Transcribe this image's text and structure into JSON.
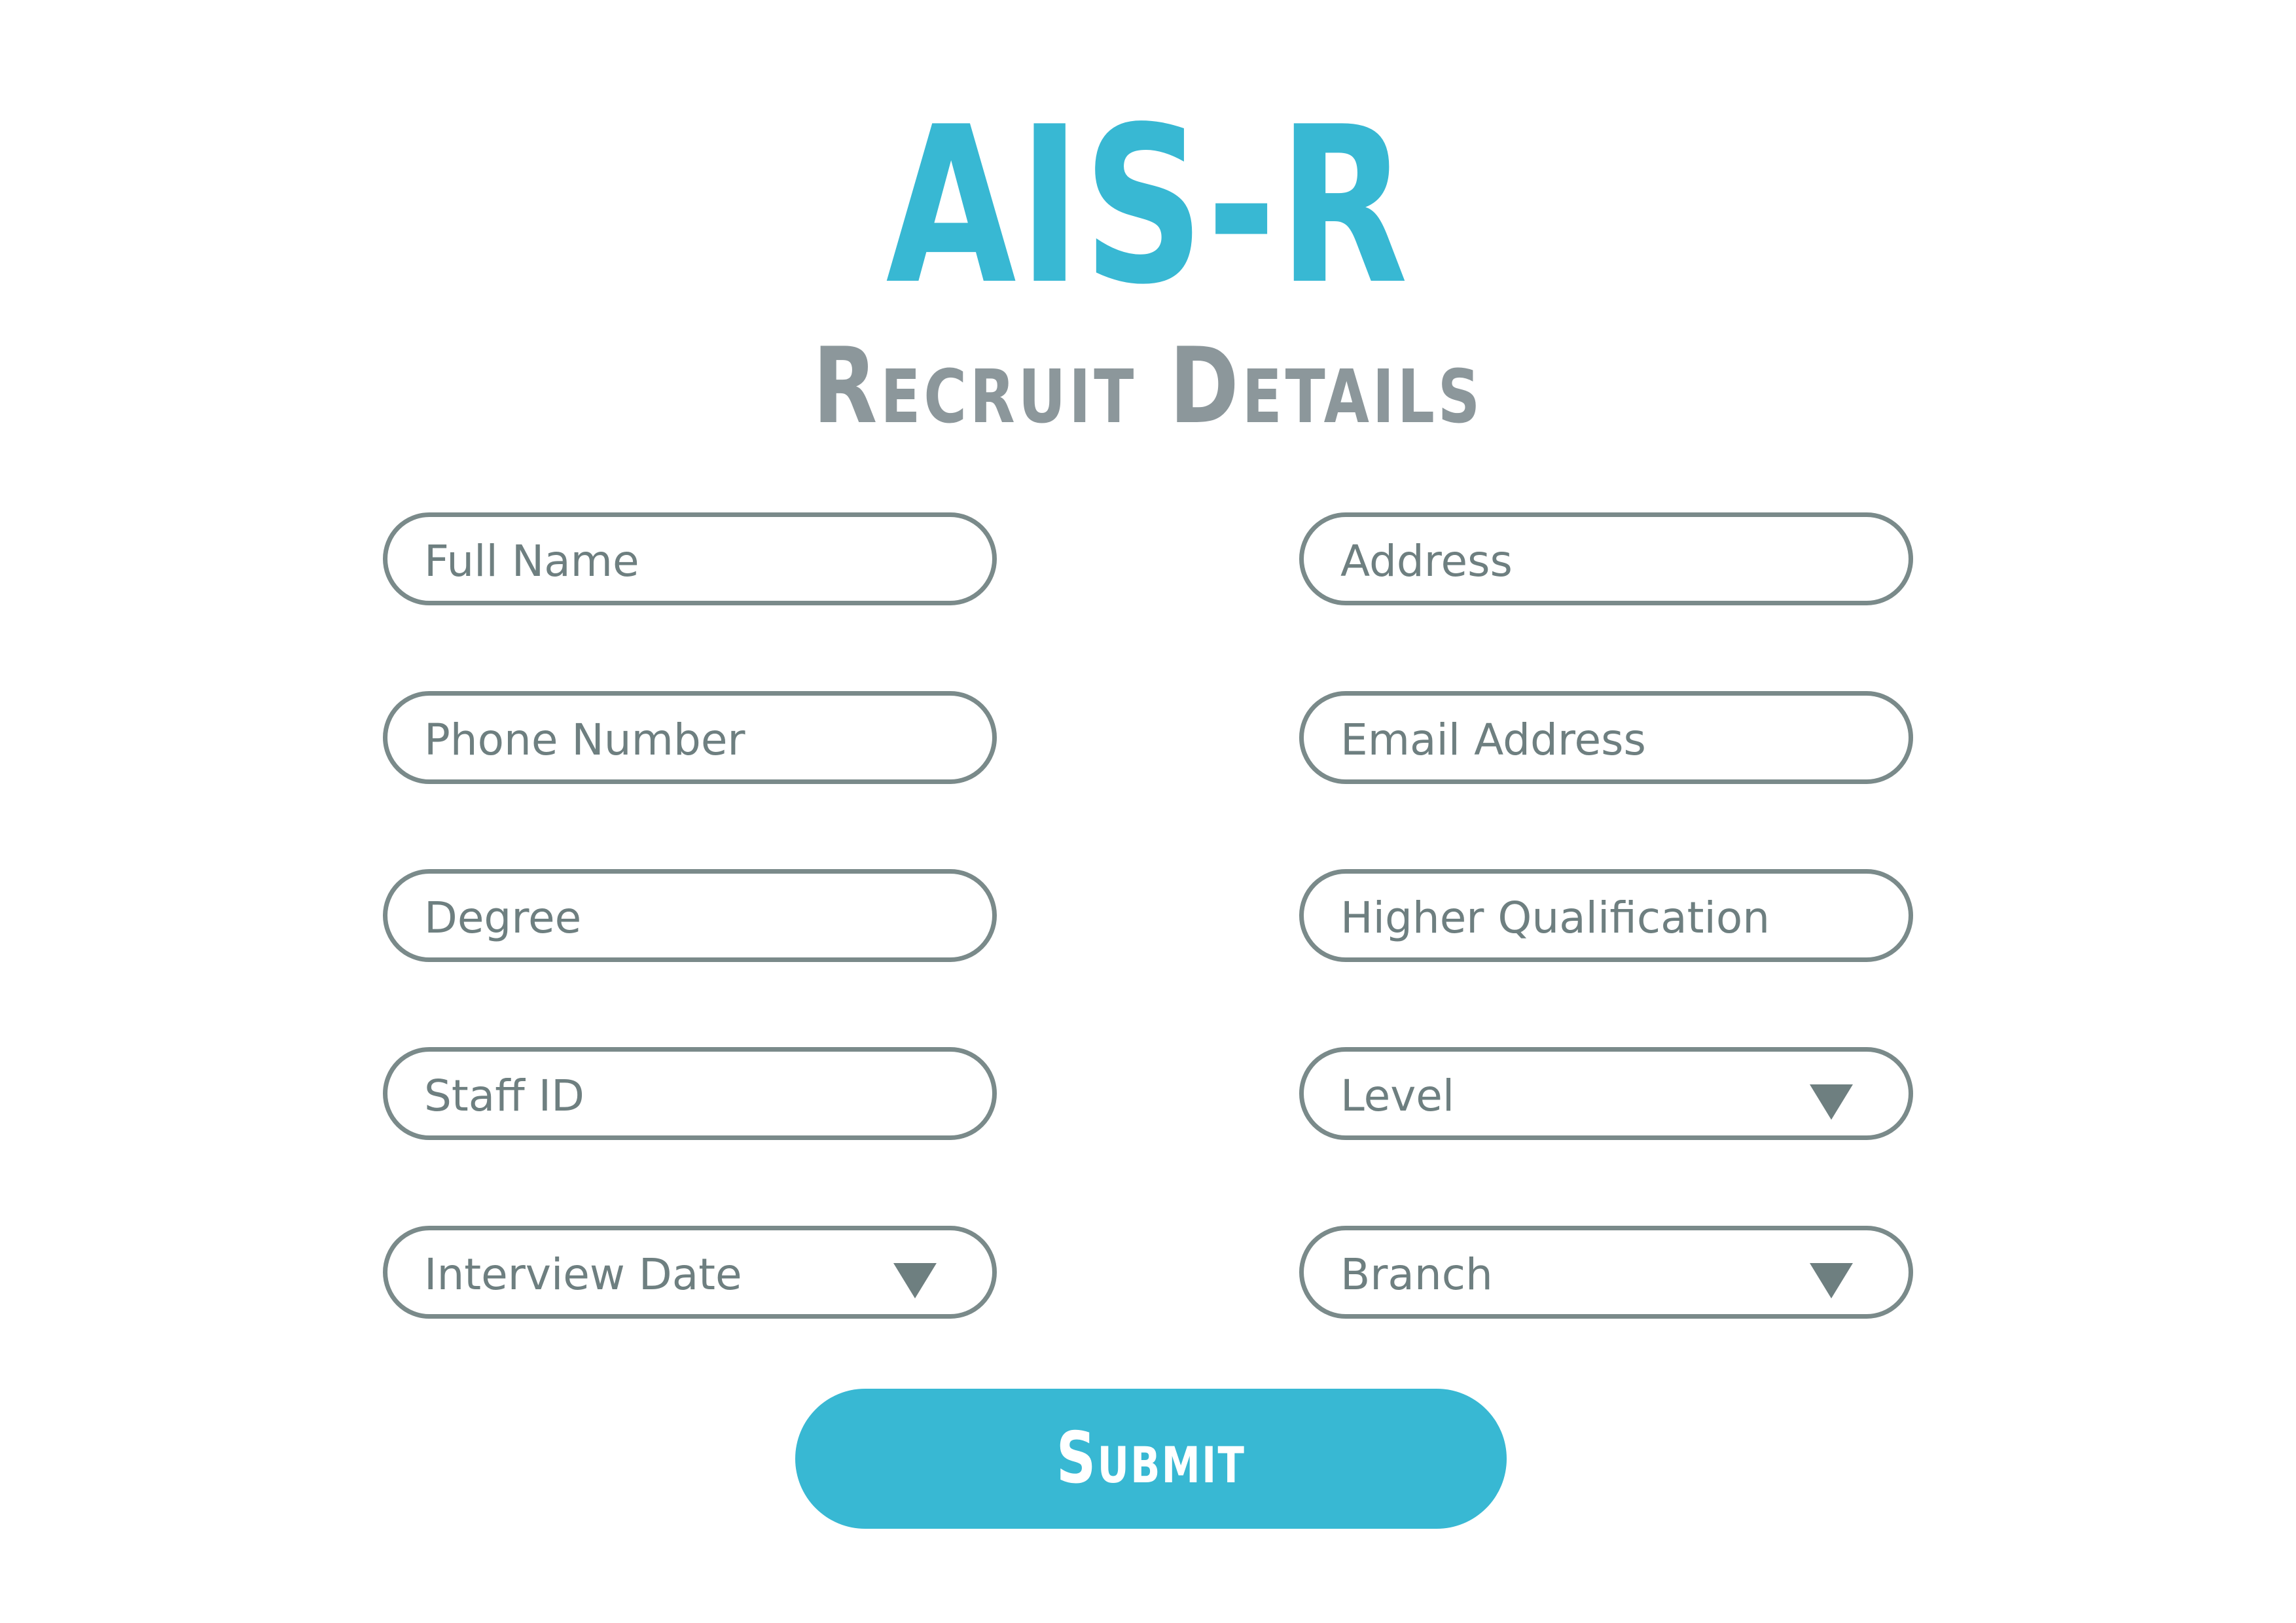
{
  "header": {
    "title": "AIS-R",
    "subtitle": "Recruit Details"
  },
  "form": {
    "left_fields": [
      {
        "label": "Full Name",
        "type": "text"
      },
      {
        "label": "Phone Number",
        "type": "text"
      },
      {
        "label": "Degree",
        "type": "text"
      },
      {
        "label": "Staff ID",
        "type": "text"
      },
      {
        "label": "Interview Date",
        "type": "dropdown"
      }
    ],
    "right_fields": [
      {
        "label": "Address",
        "type": "text"
      },
      {
        "label": "Email Address",
        "type": "text"
      },
      {
        "label": "Higher Qualification",
        "type": "text"
      },
      {
        "label": "Level",
        "type": "dropdown"
      },
      {
        "label": "Branch",
        "type": "dropdown"
      }
    ],
    "submit_label": "Submit"
  },
  "colors": {
    "accent": "#38b8d3",
    "subtitle": "#8c979b",
    "field_border": "#7a8a8a",
    "field_text": "#6e7f80",
    "background": "#ffffff"
  },
  "icons": {
    "dropdown": "triangle-down-icon"
  }
}
